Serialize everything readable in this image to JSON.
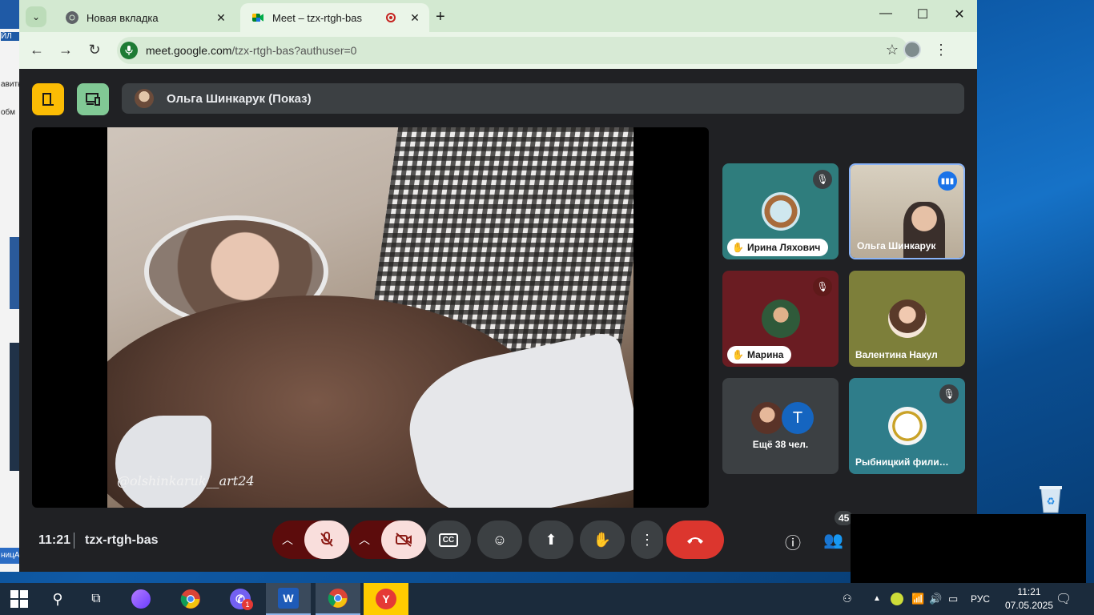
{
  "browser": {
    "tabs": [
      {
        "title": "Новая вкладка",
        "close": "✕"
      },
      {
        "title": "Meet – tzx-rtgh-bas",
        "close": "✕"
      }
    ],
    "new_tab": "+",
    "window_controls": {
      "minimize": "—",
      "maximize": "☐",
      "close": "✕"
    },
    "url_host": "meet.google.com",
    "url_path": "/tzx-rtgh-bas?authuser=0"
  },
  "background_app": {
    "fragments": [
      "ЙЛ",
      "авить",
      "обм",
      "ницА"
    ]
  },
  "meet": {
    "presenter": "Ольга Шинкарук (Показ)",
    "watermark": "@olshinkaruk__art24",
    "participants": [
      {
        "name": "Ирина Ляхович",
        "hand_raised": true,
        "muted": true,
        "bg": "#2f7d7d"
      },
      {
        "name": "Ольга Шинкарук",
        "speaking": true,
        "bg": "#c9c0b0"
      },
      {
        "name": "Марина",
        "hand_raised": true,
        "muted": true,
        "bg": "#6a1c22"
      },
      {
        "name": "Валентина Накул",
        "bg": "#7d7f3a"
      },
      {
        "name": "Ещё 38 чел.",
        "initial": "T",
        "bg": "#3c4043"
      },
      {
        "name": "Рыбницкий фили…",
        "muted": true,
        "bg": "#2f7d8a"
      }
    ],
    "clock": "11:21",
    "meeting_code": "tzx-rtgh-bas",
    "participant_count": "45"
  },
  "taskbar": {
    "language": "РУС",
    "time": "11:21",
    "date": "07.05.2025",
    "viber_badge": "1",
    "word_letter": "W",
    "yandex_letter": "Y"
  },
  "colors": {
    "accent_yellow": "#fbbc04",
    "accent_green": "#81c995",
    "end_call": "#dc362e",
    "muted_pill": "#f9dedc"
  }
}
